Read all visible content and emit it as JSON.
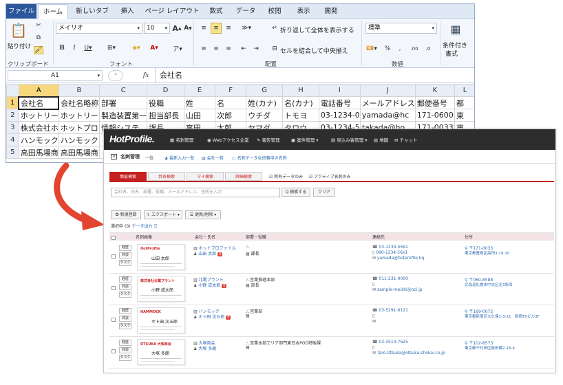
{
  "excel": {
    "tabs": [
      "ファイル",
      "ホーム",
      "新しいタブ",
      "挿入",
      "ページ レイアウト",
      "数式",
      "データ",
      "校閲",
      "表示",
      "開発"
    ],
    "clipboard": {
      "paste": "貼り付け",
      "group": "クリップボード"
    },
    "font": {
      "name": "メイリオ",
      "size": "10",
      "group": "フォント"
    },
    "align": {
      "wrap": "折り返して全体を表示する",
      "merge": "セルを結合して中央揃え",
      "group": "配置"
    },
    "number": {
      "format": "標準",
      "group": "数値"
    },
    "styles": {
      "cond": "条件付き",
      "cond2": "書式"
    },
    "namebox": "A1",
    "formula": "会社名",
    "fx": "fx",
    "columns": [
      "A",
      "B",
      "C",
      "D",
      "E",
      "F",
      "G",
      "H",
      "I",
      "J",
      "K",
      "L"
    ],
    "rows": [
      [
        "会社名",
        "会社名略称",
        "部署",
        "役職",
        "姓",
        "名",
        "姓(カナ)",
        "名(カナ)",
        "電話番号",
        "メールアドレス",
        "郵便番号",
        "都"
      ],
      [
        "ホットリー",
        "ホットリー",
        "製造装置第一",
        "担当部長",
        "山田",
        "次郎",
        "ウチダ",
        "トモヨ",
        "03-1234-0",
        "yamada@hc",
        "171-0600",
        "東"
      ],
      [
        "株式会社ホ",
        "ホットプロ",
        "情報システ",
        "課長",
        "高田",
        "太郎",
        "ヤマダ",
        "タロウ",
        "03-1234-5",
        "takada@ho",
        "171-0033",
        "東"
      ],
      [
        "ハンモック",
        "ハンモック",
        "",
        "",
        "",
        "",
        "",
        "",
        "",
        "",
        "",
        ""
      ],
      [
        "高田馬場商",
        "高田馬場商",
        "",
        "",
        "",
        "",
        "",
        "",
        "",
        "",
        "",
        ""
      ]
    ]
  },
  "hp": {
    "logo": "HotProfile.",
    "nav": [
      "名刺管理",
      "Webアクセス企業",
      "報告管理",
      "案件管理 ▾",
      "見込み客管理 ▾",
      "地図",
      "チャット"
    ],
    "sub": [
      "名刺管理",
      "一覧",
      "最新入力一覧",
      "会社一覧",
      "名刺データ化依頼中の名刺"
    ],
    "search_tabs": [
      "簡易検索",
      "共有検索",
      "マイ検索",
      "詳細検索"
    ],
    "checks": [
      "所有データのみ",
      "アクティブ名刺のみ"
    ],
    "search_placeholder": "会社名、氏名、部署、役職、メールアドレス、住所を入力",
    "search_btn": "Q 検索する",
    "clear_btn": "クリア",
    "action_btns": [
      "新規登録",
      "エクスポート ▾",
      "更新/削除 ▾"
    ],
    "selected": "選択中",
    "selected_count": "(0)",
    "data_export": "データ出力",
    "headers": [
      "名刺画像",
      "会社・氏名",
      "部署・役職",
      "連絡先",
      "住所"
    ],
    "row_btns": [
      "経歴",
      "商談",
      "タスク"
    ],
    "rows": [
      {
        "company": "ホットプロファイル",
        "name": "山田 太郎",
        "badge": "0",
        "dept": "",
        "title": "課長",
        "tel": "03-1234-5691",
        "mobile": "090-1234-56x1",
        "email": "yamada@hotprofile.kq",
        "zip": "〒171-0033",
        "addr": "東京都豊島区高田3-19-10",
        "card_logo": "HotProfile",
        "card_name": "山田 太郎"
      },
      {
        "company": "北電プラント",
        "name": "小野 成太郎",
        "badge": "0",
        "dept": "営業推進本部",
        "title": "部長",
        "tel": "011-231-0000",
        "mobile": "",
        "email": "sample-meishi@oci.jp",
        "zip": "〒060-8588",
        "addr": "北海道札幌市中央区北3条西",
        "card_logo": "株式会社北電プラント",
        "card_name": "小野 成太郎"
      },
      {
        "company": "ハンモック",
        "name": "ホト田 次五郎",
        "badge": "0",
        "dept": "営業部",
        "title": "",
        "tel": "03-5291-6121",
        "mobile": "",
        "email": "",
        "zip": "〒169-0072",
        "addr": "東京都新宿区大久保1-3-21　新宿TXビル3F",
        "card_logo": "HAMMOCK",
        "card_name": "ホト田 次五郎"
      },
      {
        "company": "大塚商会",
        "name": "大塚 多朗",
        "badge": "",
        "dept": "営業本部エリア部門東日本POD特販課",
        "title": "",
        "tel": "03-3514-7625",
        "mobile": "",
        "email": "Taro.Otsuka@otsuka-shokai.co.jp",
        "zip": "〒102-8573",
        "addr": "東京都千代田区飯田橋2-18-4",
        "card_logo": "OTSUKA 大塚商会",
        "card_name": "大塚 多朗"
      }
    ]
  },
  "colors": {
    "excel_file_tab": "#2a579a",
    "hp_header": "#2d2d2d",
    "hp_accent": "#c51f1f",
    "arrow": "#e2442f",
    "link": "#2a6ab1"
  }
}
